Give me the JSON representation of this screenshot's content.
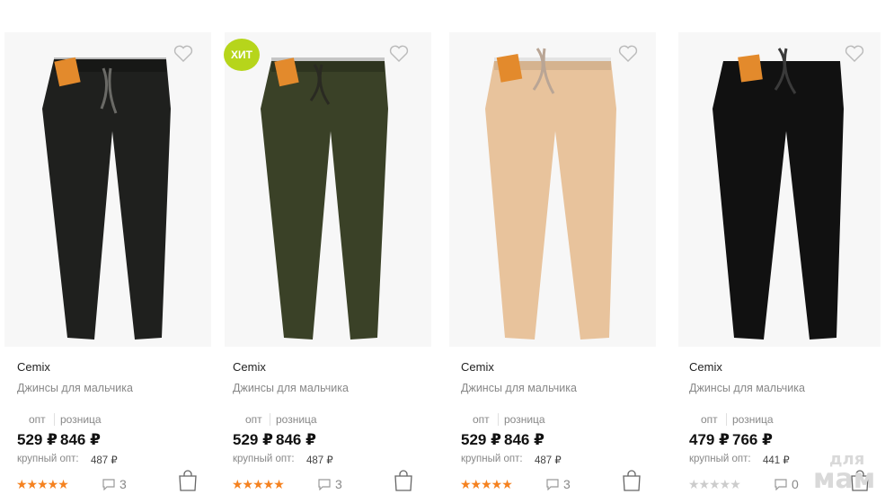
{
  "products": [
    {
      "brand": "Cemix",
      "title": "Джинсы для мальчика",
      "opt_label": "опт",
      "retail_label": "розница",
      "price_opt": "529 ₽",
      "price_retail": "846 ₽",
      "big_opt_label": "крупный опт:",
      "big_opt_price": "487 ₽",
      "rating": 5,
      "comments": "3",
      "pants_color": "#1f201e",
      "badge": ""
    },
    {
      "brand": "Cemix",
      "title": "Джинсы для мальчика",
      "opt_label": "опт",
      "retail_label": "розница",
      "price_opt": "529 ₽",
      "price_retail": "846 ₽",
      "big_opt_label": "крупный опт:",
      "big_opt_price": "487 ₽",
      "rating": 5,
      "comments": "3",
      "pants_color": "#3a4127",
      "badge": "ХИТ"
    },
    {
      "brand": "Cemix",
      "title": "Джинсы для мальчика",
      "opt_label": "опт",
      "retail_label": "розница",
      "price_opt": "529 ₽",
      "price_retail": "846 ₽",
      "big_opt_label": "крупный опт:",
      "big_opt_price": "487 ₽",
      "rating": 5,
      "comments": "3",
      "pants_color": "#e8c39c",
      "badge": ""
    },
    {
      "brand": "Cemix",
      "title": "Джинсы для мальчика",
      "opt_label": "опт",
      "retail_label": "розница",
      "price_opt": "479 ₽",
      "price_retail": "766 ₽",
      "big_opt_label": "крупный опт:",
      "big_opt_price": "441 ₽",
      "rating": 0,
      "comments": "0",
      "pants_color": "#111111",
      "badge": ""
    }
  ],
  "colors": {
    "star_on": "#f58220",
    "star_off": "#cccccc",
    "badge_bg": "#b6d51b"
  },
  "icons": {
    "favorite": "heart-outline-icon",
    "cart": "shopping-bag-icon",
    "comments": "speech-bubble-icon"
  },
  "watermark": {
    "line1": "для",
    "line2": "мам"
  }
}
